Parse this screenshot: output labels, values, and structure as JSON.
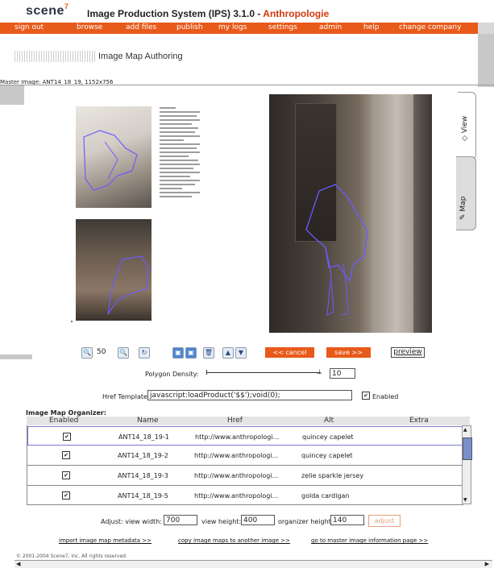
{
  "header": {
    "logo_text": "scene",
    "logo_sup": "7",
    "app_title": "Image Production System (IPS) 3.1.0 - ",
    "company": "Anthropologie"
  },
  "menu": [
    {
      "label": "sign out"
    },
    {
      "label": "browse"
    },
    {
      "label": "add files"
    },
    {
      "label": "publish"
    },
    {
      "label": "my logs"
    },
    {
      "label": "settings"
    },
    {
      "label": "admin"
    },
    {
      "label": "help"
    },
    {
      "label": "change company"
    }
  ],
  "page": {
    "section_title": "Image Map Authoring",
    "master_image": "Master Image: ANT14_18_19, 1152x756"
  },
  "tabs": {
    "view": "View",
    "map": "Map"
  },
  "toolbar": {
    "zoom": "50",
    "cancel": "<< cancel",
    "save": "save >>",
    "preview": "preview"
  },
  "polygon": {
    "label": "Polygon Density:",
    "value": "10"
  },
  "href_template": {
    "label": "Href Template:",
    "value": "javascript:loadProduct('$$');void(0);",
    "enabled_label": "Enabled",
    "enabled": true
  },
  "organizer": {
    "label": "Image Map Organizer:",
    "columns": [
      "Enabled",
      "Name",
      "Href",
      "Alt",
      "Extra"
    ],
    "rows": [
      {
        "name": "ANT14_18_19-1",
        "href": "http://www.anthropologi...",
        "alt": "quincey capelet",
        "extra": ""
      },
      {
        "name": "ANT14_18_19-2",
        "href": "http://www.anthropologi...",
        "alt": "quincey capelet",
        "extra": ""
      },
      {
        "name": "ANT14_18_19-3",
        "href": "http://www.anthropologi...",
        "alt": "zelie sparkle jersey",
        "extra": ""
      },
      {
        "name": "ANT14_18_19-5",
        "href": "http://www.anthropologi...",
        "alt": "golda cardigan",
        "extra": ""
      }
    ]
  },
  "adjust": {
    "width_label": "Adjust: view width:",
    "width": "700",
    "height_label": "view height:",
    "height": "400",
    "org_label": "organizer height:",
    "org": "140",
    "button": "adjust"
  },
  "links": {
    "import": "import image map metadata >>",
    "copy": "copy image maps to another image >>",
    "goto": "go to master image information page >>"
  },
  "copyright": "© 2001-2004 Scene7, Inc. All rights reserved.",
  "colors": {
    "brand": "#e85a1a",
    "company": "#d4380d"
  }
}
